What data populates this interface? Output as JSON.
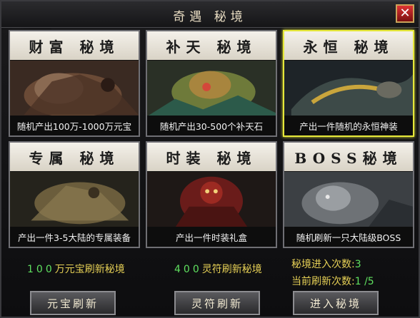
{
  "window": {
    "title": "奇遇 秘境",
    "close_label": "✕"
  },
  "cards": [
    {
      "title": "财富 秘境",
      "caption": "随机产出100万-1000万元宝",
      "selected": false
    },
    {
      "title": "补天 秘境",
      "caption": "随机产出30-500个补天石",
      "selected": false
    },
    {
      "title": "永恒 秘境",
      "caption": "产出一件随机的永恒神装",
      "selected": true
    },
    {
      "title": "专属 秘境",
      "caption": "产出一件3-5大陆的专属装备",
      "selected": false
    },
    {
      "title": "时装 秘境",
      "caption": "产出一件时装礼盒",
      "selected": false
    },
    {
      "title": "BOSS秘境",
      "caption": "随机刷新一只大陆级BOSS",
      "selected": false
    }
  ],
  "refresh_costs": {
    "yuanbao_number": "100",
    "yuanbao_text": "万元宝刷新秘境",
    "lingfu_number": "400",
    "lingfu_text": "灵符刷新秘境"
  },
  "counts": {
    "enter_label": "秘境进入次数:",
    "enter_value": "3",
    "refresh_label": "当前刷新次数:",
    "refresh_value": "1 /5"
  },
  "buttons": {
    "yuanbao_refresh": "元宝刷新",
    "lingfu_refresh": "灵符刷新",
    "enter": "进入秘境"
  }
}
